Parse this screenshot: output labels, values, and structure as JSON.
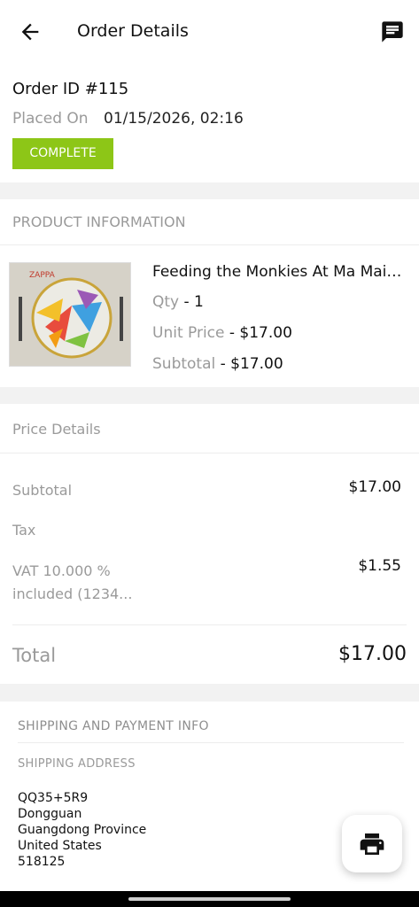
{
  "header": {
    "title": "Order Details"
  },
  "order": {
    "id_label": "Order ID #115",
    "placed_label": "Placed On",
    "placed_value": "01/15/2026, 02:16",
    "status": "COMPLETE",
    "status_color": "#8dc617"
  },
  "product_section": {
    "title": "PRODUCT INFORMATION",
    "item": {
      "name": "Feeding the Monkies At Ma Maison",
      "qty_label": "Qty",
      "qty_value": "- 1",
      "unit_price_label": "Unit Price",
      "unit_price_value": "- $17.00",
      "subtotal_label": "Subtotal",
      "subtotal_value": "- $17.00"
    }
  },
  "price_details": {
    "title": "Price Details",
    "subtotal_label": "Subtotal",
    "subtotal_value": "$17.00",
    "tax_label": "Tax",
    "vat_line1": "VAT 10.000 %",
    "vat_line2": "included (1234...",
    "vat_value": "$1.55",
    "total_label": "Total",
    "total_value": "$17.00"
  },
  "shipping": {
    "title": "SHIPPING AND PAYMENT INFO",
    "address_title": "SHIPPING ADDRESS",
    "address_lines": [
      "QQ35+5R9",
      "Dongguan",
      "Guangdong Province",
      "United States",
      "518125"
    ]
  },
  "icons": {
    "back": "arrow-left-icon",
    "chat": "chat-icon",
    "print": "printer-icon"
  }
}
